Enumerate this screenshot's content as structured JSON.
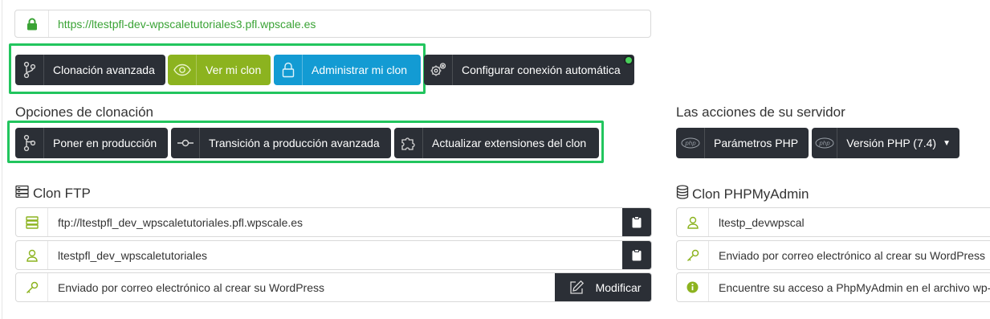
{
  "url_bar": {
    "url": "https://ltestpfl-dev-wpscaletutoriales3.pfl.wpscale.es",
    "icon": "lock-icon"
  },
  "toolbar": {
    "advanced_clone": "Clonación avanzada",
    "view_clone": "Ver mi clon",
    "manage_clone": "Administrar mi clon",
    "auto_connection": "Configurar conexión automática"
  },
  "clone_options": {
    "title": "Opciones de clonación",
    "to_production": "Poner en producción",
    "advanced_transition": "Transición a producción avanzada",
    "update_extensions": "Actualizar extensiones del clon"
  },
  "server_actions": {
    "title": "Las acciones de su servidor",
    "php_params": "Parámetros PHP",
    "php_version": "Versión PHP (7.4)"
  },
  "ftp": {
    "title": "Clon FTP",
    "host": "ftp://ltestpfl_dev_wpscaletutoriales.pfl.wpscale.es",
    "user": "ltestpfl_dev_wpscaletutoriales",
    "password": "Enviado por correo electrónico al crear su WordPress",
    "modify": "Modificar"
  },
  "phpmyadmin": {
    "title": "Clon PHPMyAdmin",
    "user": "ltestp_devwpscal",
    "password": "Enviado por correo electrónico al crear su WordPress",
    "info": "Encuentre su acceso a PhpMyAdmin en el archivo wp-"
  },
  "colors": {
    "dark_button": "#2b2f36",
    "olive_button": "#8cb31f",
    "blue_button": "#139bd3",
    "highlight": "#22c55e",
    "url_text": "#3aa335",
    "icon_accent": "#8cb31f"
  }
}
